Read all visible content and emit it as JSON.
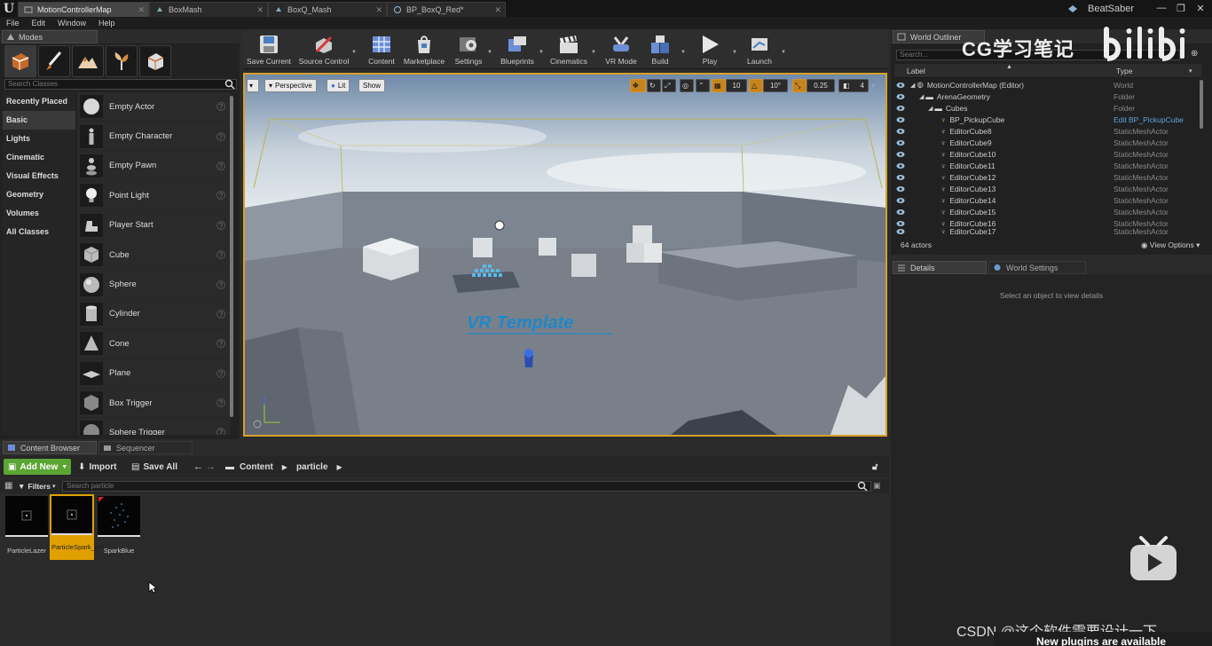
{
  "titlebar": {
    "tabs": [
      {
        "label": "MotionControllerMap",
        "active": true
      },
      {
        "label": "BoxMash",
        "active": false
      },
      {
        "label": "BoxQ_Mash",
        "active": false
      },
      {
        "label": "BP_BoxQ_Red*",
        "active": false
      }
    ],
    "project": "BeatSaber"
  },
  "menu": [
    "File",
    "Edit",
    "Window",
    "Help"
  ],
  "modes": {
    "tab": "Modes",
    "search_placeholder": "Search Classes",
    "categories": [
      "Recently Placed",
      "Basic",
      "Lights",
      "Cinematic",
      "Visual Effects",
      "Geometry",
      "Volumes",
      "All Classes"
    ],
    "items": [
      "Empty Actor",
      "Empty Character",
      "Empty Pawn",
      "Point Light",
      "Player Start",
      "Cube",
      "Sphere",
      "Cylinder",
      "Cone",
      "Plane",
      "Box Trigger",
      "Sphere Trigger"
    ]
  },
  "toolbar": [
    "Save Current",
    "Source Control",
    "Content",
    "Marketplace",
    "Settings",
    "Blueprints",
    "Cinematics",
    "VR Mode",
    "Build",
    "Play",
    "Launch"
  ],
  "viewport": {
    "perspective": "Perspective",
    "lit": "Lit",
    "show": "Show",
    "grid_snap": "10",
    "rot_snap": "10°",
    "scale_snap": "0.25",
    "cam_speed": "4",
    "scene_text": "VR Template"
  },
  "outliner": {
    "tab": "World Outliner",
    "search_placeholder": "Search...",
    "col_label": "Label",
    "col_type": "Type",
    "rows": [
      {
        "label": "MotionControllerMap (Editor)",
        "type": "World"
      },
      {
        "label": "ArenaGeometry",
        "type": "Folder"
      },
      {
        "label": "Cubes",
        "type": "Folder"
      },
      {
        "label": "BP_PickupCube",
        "type": "Edit BP_PickupCube"
      },
      {
        "label": "EditorCube8",
        "type": "StaticMeshActor"
      },
      {
        "label": "EditorCube9",
        "type": "StaticMeshActor"
      },
      {
        "label": "EditorCube10",
        "type": "StaticMeshActor"
      },
      {
        "label": "EditorCube11",
        "type": "StaticMeshActor"
      },
      {
        "label": "EditorCube12",
        "type": "StaticMeshActor"
      },
      {
        "label": "EditorCube13",
        "type": "StaticMeshActor"
      },
      {
        "label": "EditorCube14",
        "type": "StaticMeshActor"
      },
      {
        "label": "EditorCube15",
        "type": "StaticMeshActor"
      },
      {
        "label": "EditorCube16",
        "type": "StaticMeshActor"
      },
      {
        "label": "EditorCube17",
        "type": "StaticMeshActor"
      }
    ],
    "count": "64 actors",
    "view_options": "View Options"
  },
  "details": {
    "tab": "Details",
    "ws_tab": "World Settings",
    "message": "Select an object to view details"
  },
  "content_browser": {
    "tab": "Content Browser",
    "seq_tab": "Sequencer",
    "add_new": "Add New",
    "import": "Import",
    "save_all": "Save All",
    "path": [
      "Content",
      "particle"
    ],
    "filters": "Filters",
    "search_placeholder": "Search particle",
    "assets": [
      {
        "name": "ParticleLazer",
        "selected": false
      },
      {
        "name": "ParticleSpark_red",
        "selected": true
      },
      {
        "name": "SparkBlue",
        "selected": false
      }
    ]
  },
  "watermarks": {
    "cg": "CG学习笔记",
    "csdn": "CSDN @这个软件需要设计一下",
    "notice": "New plugins are available"
  }
}
